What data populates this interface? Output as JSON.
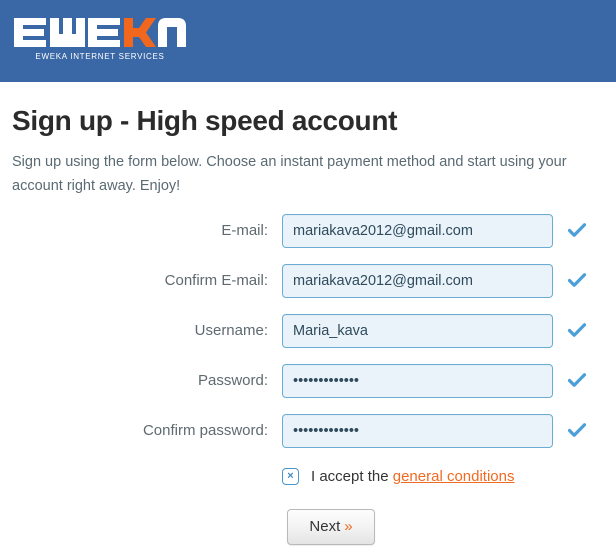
{
  "header": {
    "logo_text": "EWEKA",
    "logo_accent_letter": "K",
    "logo_tagline": "EWEKA INTERNET SERVICES",
    "background_color": "#3a67a5",
    "accent_color": "#f06a22"
  },
  "page": {
    "title": "Sign up - High speed account",
    "subtitle": "Sign up using the form below. Choose an instant payment method and start using your account right away. Enjoy!"
  },
  "form": {
    "fields": [
      {
        "label": "E-mail:",
        "value": "mariakava2012@gmail.com",
        "placeholder": "",
        "type": "text",
        "valid": true,
        "valid_icon": "check-icon"
      },
      {
        "label": "Confirm E-mail:",
        "value": "mariakava2012@gmail.com",
        "placeholder": "",
        "type": "text",
        "valid": true,
        "valid_icon": "check-icon"
      },
      {
        "label": "Username:",
        "value": "Maria_kava",
        "placeholder": "",
        "type": "text",
        "valid": true,
        "valid_icon": "check-icon"
      },
      {
        "label": "Password:",
        "value": "•••••••••••••",
        "placeholder": "",
        "type": "password",
        "valid": true,
        "valid_icon": "check-icon"
      },
      {
        "label": "Confirm password:",
        "value": "•••••••••••••",
        "placeholder": "",
        "type": "password",
        "valid": true,
        "valid_icon": "check-icon"
      }
    ],
    "terms": {
      "checkbox_mark": "×",
      "checked": true,
      "text_prefix": "I accept the",
      "link_text": "general conditions",
      "link_color": "#f06a22"
    },
    "submit": {
      "label": "Next",
      "chevron": "»"
    }
  },
  "colors": {
    "input_border": "#6aadd4",
    "input_background": "#eaf3fa",
    "check_icon": "#4a9fd8",
    "label_text": "#5e6a70",
    "title_text": "#2b2b2b"
  }
}
